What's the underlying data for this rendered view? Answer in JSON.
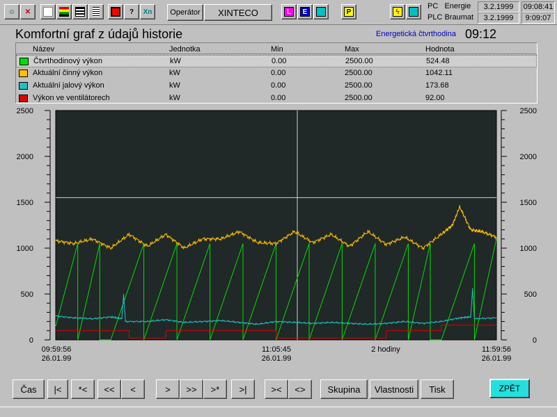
{
  "toolbar": {
    "operator_label": "Operátor",
    "operator_value": "XINTECO",
    "icons": [
      "users-icon",
      "remove-user-icon",
      "blank-icon",
      "color-list-icon",
      "list-icon",
      "document-icon",
      "terminal-icon",
      "help-icon",
      "xn-icon",
      "l-icon",
      "e-icon",
      "window-icon",
      "p-icon",
      "lightning-icon",
      "settings-icon"
    ],
    "status": {
      "pc_label": "PC",
      "pc_name": "Energie",
      "pc_date": "3.2.1999",
      "pc_time": "09:08:41",
      "plc_label": "PLC",
      "plc_name": "Braumat",
      "plc_date": "3.2.1999",
      "plc_time": "9:09:07"
    }
  },
  "page": {
    "title": "Komfortní graf z údajů historie",
    "subtitle": "Energetická čtvrthodina",
    "clock": "09:12"
  },
  "legend": {
    "headers": {
      "name": "Název",
      "unit": "Jednotka",
      "min": "Min",
      "max": "Max",
      "value": "Hodnota"
    },
    "rows": [
      {
        "name": "Čtvrthodinový výkon",
        "unit": "kW",
        "min": "0.00",
        "max": "2500.00",
        "value": "524.48",
        "color": "#00e000"
      },
      {
        "name": "Aktuální činný výkon",
        "unit": "kW",
        "min": "0.00",
        "max": "2500.00",
        "value": "1042.11",
        "color": "#ffc000"
      },
      {
        "name": "Aktuální jalový výkon",
        "unit": "kW",
        "min": "0.00",
        "max": "2500.00",
        "value": "173.68",
        "color": "#20c0c0"
      },
      {
        "name": "Výkon ve ventilátorech",
        "unit": "kW",
        "min": "0.00",
        "max": "2500.00",
        "value": "92.00",
        "color": "#e00000"
      }
    ]
  },
  "chart_data": {
    "type": "line",
    "ylim": [
      0,
      2500
    ],
    "y_ticks": [
      "0",
      "500",
      "1000",
      "1500",
      "2000",
      "2500"
    ],
    "x_labels": [
      {
        "time": "09:59:56",
        "date": "26.01.99"
      },
      {
        "time": "11:05:45",
        "date": "26.01.99"
      },
      {
        "time": "2 hodiny",
        "date": ""
      },
      {
        "time": "11:59:56",
        "date": "26.01.99"
      }
    ],
    "duration": "2 hodiny",
    "grid": "crosshair",
    "background": "#202828",
    "series": [
      {
        "name": "Čtvrthodinový výkon",
        "color": "#00e000",
        "shape": "sawtooth",
        "x": [
          0,
          0.6,
          0.6,
          1.2,
          1.2,
          1.5,
          1.5,
          2.4,
          2.4,
          3.3,
          3.3,
          4.2,
          4.2,
          5.1,
          5.1,
          6.0,
          6.0,
          6.9,
          6.9,
          7.8,
          7.8,
          8.7,
          8.7,
          9.6,
          9.6,
          10.2,
          10.2,
          10.5,
          10.5,
          11.4,
          11.4,
          12.0
        ],
        "y": [
          150,
          1050,
          0,
          1050,
          0,
          0,
          0,
          1050,
          0,
          1050,
          0,
          1050,
          0,
          1050,
          0,
          1050,
          0,
          1050,
          0,
          1050,
          0,
          1050,
          0,
          1050,
          0,
          1050,
          0,
          0,
          0,
          1050,
          0,
          1100
        ]
      },
      {
        "name": "Aktuální činný výkon",
        "color": "#ffc000",
        "x": [
          0,
          0.5,
          1,
          1.5,
          2,
          2.5,
          3,
          3.5,
          4,
          4.5,
          5,
          5.5,
          6,
          6.5,
          7,
          7.5,
          8,
          8.5,
          9,
          9.5,
          10,
          10.5,
          10.8,
          11,
          11.3,
          11.6,
          12
        ],
        "y": [
          1080,
          1050,
          1100,
          1000,
          1150,
          1020,
          1150,
          1000,
          1100,
          1100,
          1180,
          1060,
          1050,
          1180,
          1060,
          1150,
          1020,
          1180,
          1040,
          1120,
          1000,
          1150,
          1250,
          1450,
          1200,
          1180,
          1120
        ]
      },
      {
        "name": "Aktuální jalový výkon",
        "color": "#20c0c0",
        "x": [
          0,
          0.5,
          1,
          1.5,
          1.8,
          1.85,
          1.9,
          2.5,
          3,
          3.5,
          4,
          4.5,
          5,
          5.5,
          6,
          6.5,
          7,
          7.5,
          8,
          8.5,
          9,
          9.5,
          10,
          10.5,
          11,
          11.3,
          11.35,
          11.4,
          12
        ],
        "y": [
          260,
          240,
          230,
          250,
          230,
          500,
          200,
          200,
          220,
          190,
          200,
          210,
          190,
          170,
          200,
          190,
          180,
          190,
          180,
          170,
          180,
          200,
          180,
          200,
          240,
          250,
          560,
          230,
          240
        ]
      },
      {
        "name": "Výkon ve ventilátorech",
        "color": "#e00000",
        "x": [
          0,
          2,
          2,
          3,
          3,
          6,
          6,
          9,
          9,
          10.5,
          10.5,
          12
        ],
        "y": [
          100,
          100,
          20,
          20,
          100,
          100,
          20,
          20,
          100,
          100,
          160,
          160
        ]
      }
    ]
  },
  "nav": {
    "buttons": [
      "Čas",
      "|<",
      "*<",
      "<<",
      "<",
      ">",
      ">>",
      ">*",
      ">|",
      "><",
      "<>",
      "Skupina",
      "Vlastnosti",
      "Tisk"
    ],
    "back": "ZPĚT"
  }
}
